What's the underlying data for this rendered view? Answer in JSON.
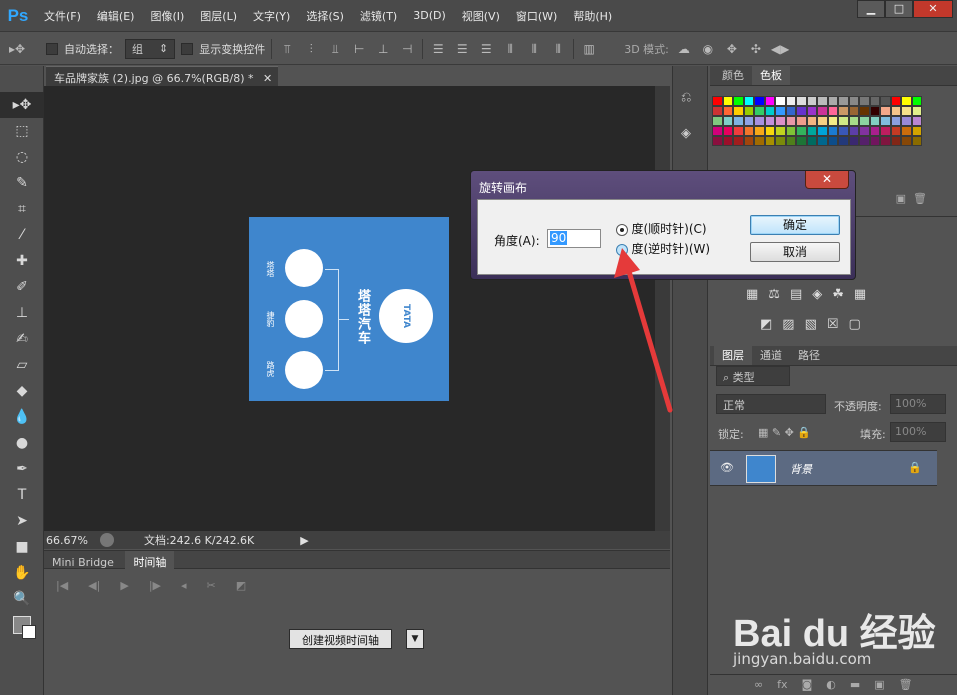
{
  "app": {
    "logo": "Ps",
    "menus": [
      "文件(F)",
      "编辑(E)",
      "图像(I)",
      "图层(L)",
      "文字(Y)",
      "选择(S)",
      "滤镜(T)",
      "3D(D)",
      "视图(V)",
      "窗口(W)",
      "帮助(H)"
    ]
  },
  "options": {
    "auto_select_label": "自动选择：",
    "auto_select_value": "组",
    "show_transform_label": "显示变换控件",
    "mode_3d_label": "3D 模式:"
  },
  "document": {
    "tab_title": "车品牌家族 (2).jpg @ 66.7%(RGB/8) *",
    "zoom": "66.67%",
    "doc_info": "文档:242.6 K/242.6K",
    "image": {
      "company_name": "塔塔汽车",
      "logo_text": "TATA",
      "sub_labels": [
        "塔塔",
        "捷豹",
        "路虎"
      ]
    }
  },
  "timeline": {
    "tabs": [
      "Mini Bridge",
      "时间轴"
    ],
    "create_button": "创建视频时间轴"
  },
  "panels": {
    "color_tabs": [
      "颜色",
      "色板"
    ],
    "layer_tabs": [
      "图层",
      "通道",
      "路径"
    ],
    "kind_filter": "类型",
    "blend_mode": "正常",
    "opacity_label": "不透明度:",
    "opacity_value": "100%",
    "lock_label": "锁定:",
    "fill_label": "填充:",
    "fill_value": "100%",
    "layer_name": "背景"
  },
  "dialog": {
    "title": "旋转画布",
    "close": "✕",
    "angle_label": "角度(A):",
    "angle_value": "90",
    "cw_label": "度(顺时针)(C)",
    "ccw_label": "度(逆时针)(W)",
    "ok": "确定",
    "cancel": "取消"
  },
  "watermark": {
    "logo": "Bai du 经验",
    "url": "jingyan.baidu.com"
  },
  "colors": {
    "accent": "#31a8ff",
    "image_blue": "#3f86cd",
    "arrow": "#e53a3a",
    "swatches": [
      "#ff0000",
      "#ffff00",
      "#00ff00",
      "#00ffff",
      "#0000ff",
      "#ff00ff",
      "#ffffff",
      "#eeeeee",
      "#dddddd",
      "#cccccc",
      "#bbbbbb",
      "#aaaaaa",
      "#999999",
      "#888888",
      "#777777",
      "#666666",
      "#555555",
      "#ff0000",
      "#ffff00",
      "#00ff00",
      "#cc3333",
      "#ff6633",
      "#ffcc00",
      "#99cc00",
      "#33cc66",
      "#00cccc",
      "#3399ff",
      "#3366cc",
      "#6633cc",
      "#9933cc",
      "#cc3399",
      "#ff6699",
      "#cc9966",
      "#996633",
      "#663300",
      "#330000",
      "#f4a88a",
      "#f5c48a",
      "#f6e28a",
      "#e0f08a",
      "#7fc97f",
      "#7fcfc8",
      "#7fb4e3",
      "#8fa3e6",
      "#a790e0",
      "#c48fdc",
      "#dd90c8",
      "#e897a8",
      "#ef9c8c",
      "#f3b482",
      "#f6cf84",
      "#f4eb86",
      "#cfe986",
      "#a7dc8a",
      "#8bd3a0",
      "#82cfc2",
      "#80bedf",
      "#8b9fdf",
      "#9a8ad8",
      "#bb86d3",
      "#d1007a",
      "#e8005d",
      "#ef3d3d",
      "#f2762b",
      "#f7a818",
      "#f8d60c",
      "#c1d41e",
      "#7fc236",
      "#33b35d",
      "#00a79d",
      "#00a3d9",
      "#1b7bd0",
      "#3957b8",
      "#5c3ea8",
      "#82329f",
      "#a91f8c",
      "#be1e5f",
      "#c43b24",
      "#cc6d0c",
      "#d2a400",
      "#8a0f3e",
      "#9b0f2a",
      "#a01d1d",
      "#a1450c",
      "#a16b00",
      "#a78f00",
      "#7b8a0a",
      "#4f7f1b",
      "#1d7436",
      "#006b60",
      "#00678e",
      "#0d4d8a",
      "#23397a",
      "#3a2870",
      "#55206a",
      "#71155e",
      "#80153f",
      "#822617",
      "#864707",
      "#8a6b00"
    ]
  }
}
